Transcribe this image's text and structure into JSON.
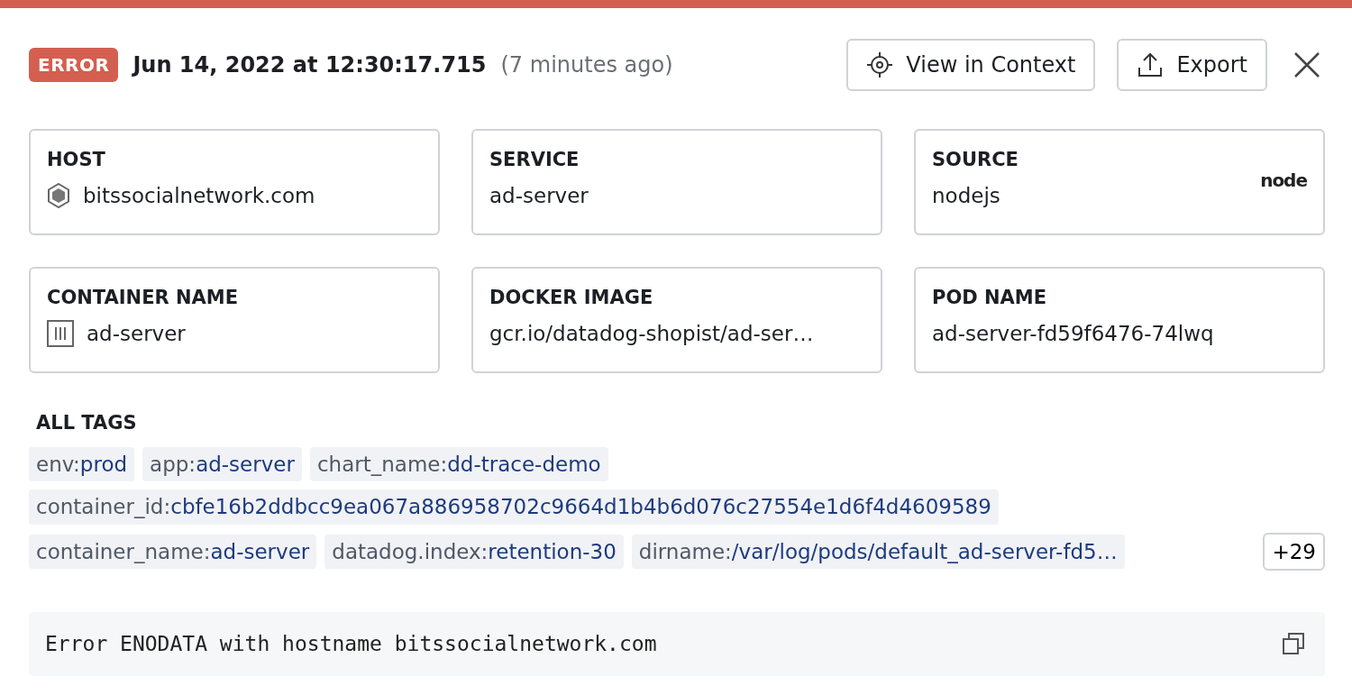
{
  "status": {
    "label": "ERROR"
  },
  "timestamp": "Jun 14, 2022 at 12:30:17.715",
  "relative_time": "(7 minutes ago)",
  "actions": [
    {
      "label": "View in Context",
      "kind": "context"
    },
    {
      "label": "Export",
      "kind": "export"
    }
  ],
  "attributes": [
    {
      "label": "HOST",
      "value": "bitssocialnetwork.com",
      "kind": "host"
    },
    {
      "label": "SERVICE",
      "value": "ad-server"
    },
    {
      "label": "SOURCE",
      "value": "nodejs",
      "logo": "node"
    },
    {
      "label": "CONTAINER NAME",
      "value": "ad-server",
      "kind": "container"
    },
    {
      "label": "DOCKER IMAGE",
      "value": "gcr.io/datadog-shopist/ad-ser…"
    },
    {
      "label": "POD NAME",
      "value": "ad-server-fd59f6476-74lwq"
    }
  ],
  "tags_title": "ALL TAGS",
  "tag_rows": [
    [
      {
        "key": "env:",
        "value": "prod"
      },
      {
        "key": "app:",
        "value": "ad-server"
      },
      {
        "key": "chart_name:",
        "value": "dd-trace-demo"
      }
    ],
    [
      {
        "key": "container_id:",
        "value": "cbfe16b2ddbcc9ea067a886958702c9664d1b4b6d076c27554e1d6f4d4609589"
      }
    ],
    [
      {
        "key": "container_name:",
        "value": "ad-server"
      },
      {
        "key": "datadog.index:",
        "value": "retention-30"
      },
      {
        "key": "dirname:",
        "value": "/var/log/pods/default_ad-server-fd5…"
      }
    ]
  ],
  "more_tags": "+29",
  "message": "Error ENODATA with hostname bitssocialnetwork.com"
}
